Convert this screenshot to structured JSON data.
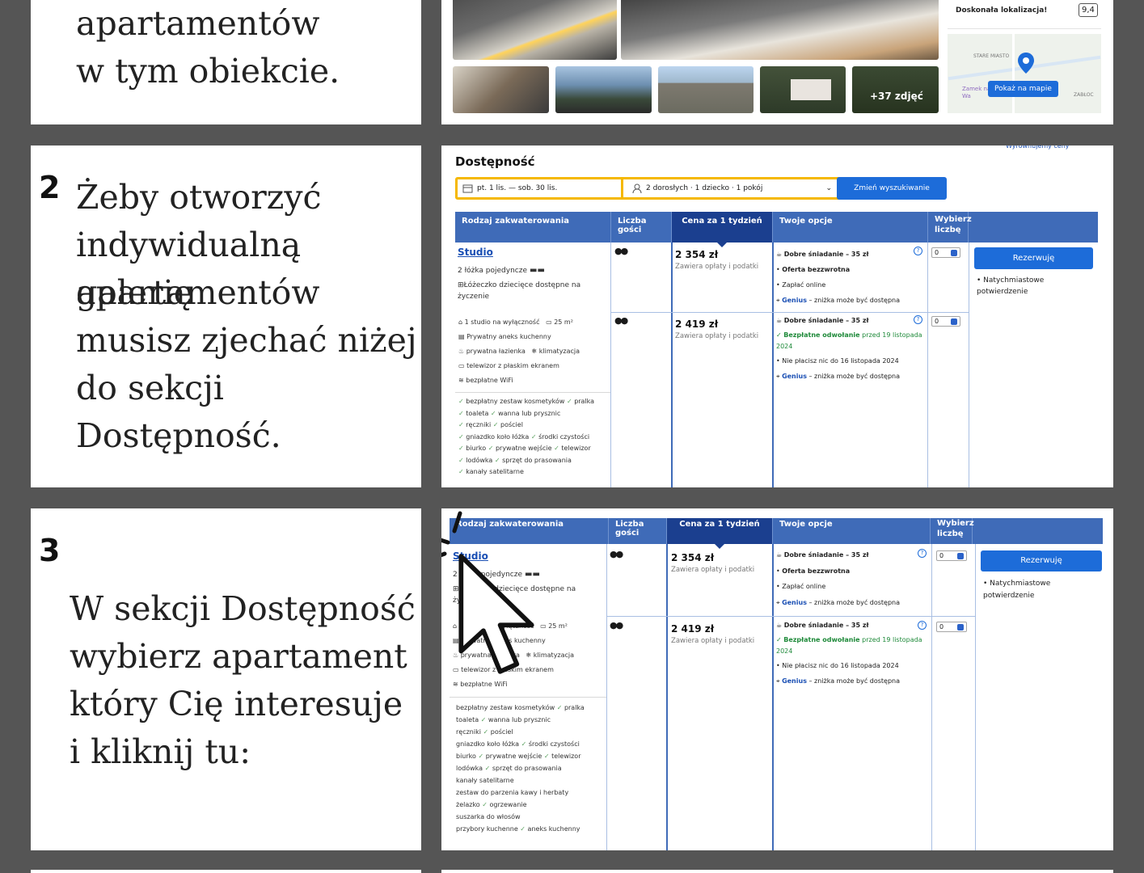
{
  "step1": {
    "text_lines": [
      "apartamentów",
      "w tym obiekcie."
    ],
    "location_label": "Doskonała lokalizacja!",
    "location_score": "9,4",
    "more_photos": "+37 zdjęć",
    "map_button": "Pokaż na mapie",
    "map_labels": [
      "STARE MIASTO",
      "Zamek na Wa",
      "ZABŁOC"
    ]
  },
  "step2": {
    "number": "2",
    "text_lines": [
      "Żeby otworzyć",
      "indywidualną galerię",
      "apartamentów",
      "musisz zjechać niżej",
      "do sekcji",
      "Dostępność."
    ],
    "section_title": "Dostępność",
    "top_right_link": "Wyrównujemy ceny",
    "search": {
      "dates": "pt. 1 lis. — sob. 30 lis.",
      "guests": "2 dorosłych · 1 dziecko · 1 pokój",
      "button": "Zmień wyszukiwanie"
    }
  },
  "step3": {
    "number": "3",
    "text_lines": [
      "W sekcji Dostępność",
      "wybierz apartament",
      "który Cię interesuje",
      "i kliknij tu:"
    ]
  },
  "table": {
    "headers": [
      "Rodzaj zakwaterowania",
      "Liczba gości",
      "Cena za 1 tydzień",
      "Twoje opcje",
      "Wybierz liczbę"
    ],
    "room_name": "Studio",
    "beds": "2 łóżka pojedyncze",
    "crib": "Łóżeczko dziecięce dostępne na życzenie",
    "features": [
      "1 studio na wyłączność",
      "25 m²",
      "Prywatny aneks kuchenny",
      "prywatna łazienka",
      "klimatyzacja",
      "telewizor z płaskim ekranem",
      "bezpłatne WiFi"
    ],
    "amenities": [
      [
        "bezpłatny zestaw kosmetyków",
        "pralka"
      ],
      [
        "toaleta",
        "wanna lub prysznic"
      ],
      [
        "ręczniki",
        "pościel"
      ],
      [
        "gniazdko koło łóżka",
        "środki czystości"
      ],
      [
        "biurko",
        "prywatne wejście",
        "telewizor"
      ],
      [
        "lodówka",
        "sprzęt do prasowania"
      ],
      [
        "kanały satelitarne"
      ]
    ],
    "amenities_extra": [
      [
        "zestaw do parzenia kawy i herbaty"
      ],
      [
        "żelazko",
        "ogrzewanie"
      ],
      [
        "suszarka do włosów"
      ],
      [
        "przybory kuchenne",
        "aneks kuchenny"
      ]
    ],
    "rows": [
      {
        "price": "2 354 zł",
        "price_note": "Zawiera opłaty i podatki",
        "options": [
          "Dobre śniadanie – 35 zł",
          "Oferta bezzwrotna",
          "Zapłać online"
        ],
        "genius": "Genius",
        "genius_rest": "– zniżka może być dostępna",
        "qty": "0"
      },
      {
        "price": "2 419 zł",
        "price_note": "Zawiera opłaty i podatki",
        "options": [
          "Dobre śniadanie – 35 zł",
          "Bezpłatne odwołanie przed 19 listopada 2024",
          "Nie płacisz nic do 16 listopada 2024"
        ],
        "cancel_bold": "Bezpłatne odwołanie",
        "cancel_rest": "przed 19 listopada 2024",
        "genius": "Genius",
        "genius_rest": "– zniżka może być dostępna",
        "qty": "0"
      }
    ],
    "reserve_button": "Rezerwuję",
    "confirmation": "Natychmiastowe potwierdzenie"
  },
  "colors": {
    "background": "#555555",
    "header_blue": "#3f6bb8",
    "header_dark": "#1b3f8f",
    "button_blue": "#1d6cd9",
    "link_blue": "#1a4fb4",
    "green": "#1f8a3a"
  },
  "icons": [
    "cursor-arrow-icon",
    "calendar-icon",
    "person-icon",
    "bed-icon",
    "guests-icon",
    "info-icon",
    "map-pin-icon",
    "check-icon",
    "tag-icon"
  ]
}
